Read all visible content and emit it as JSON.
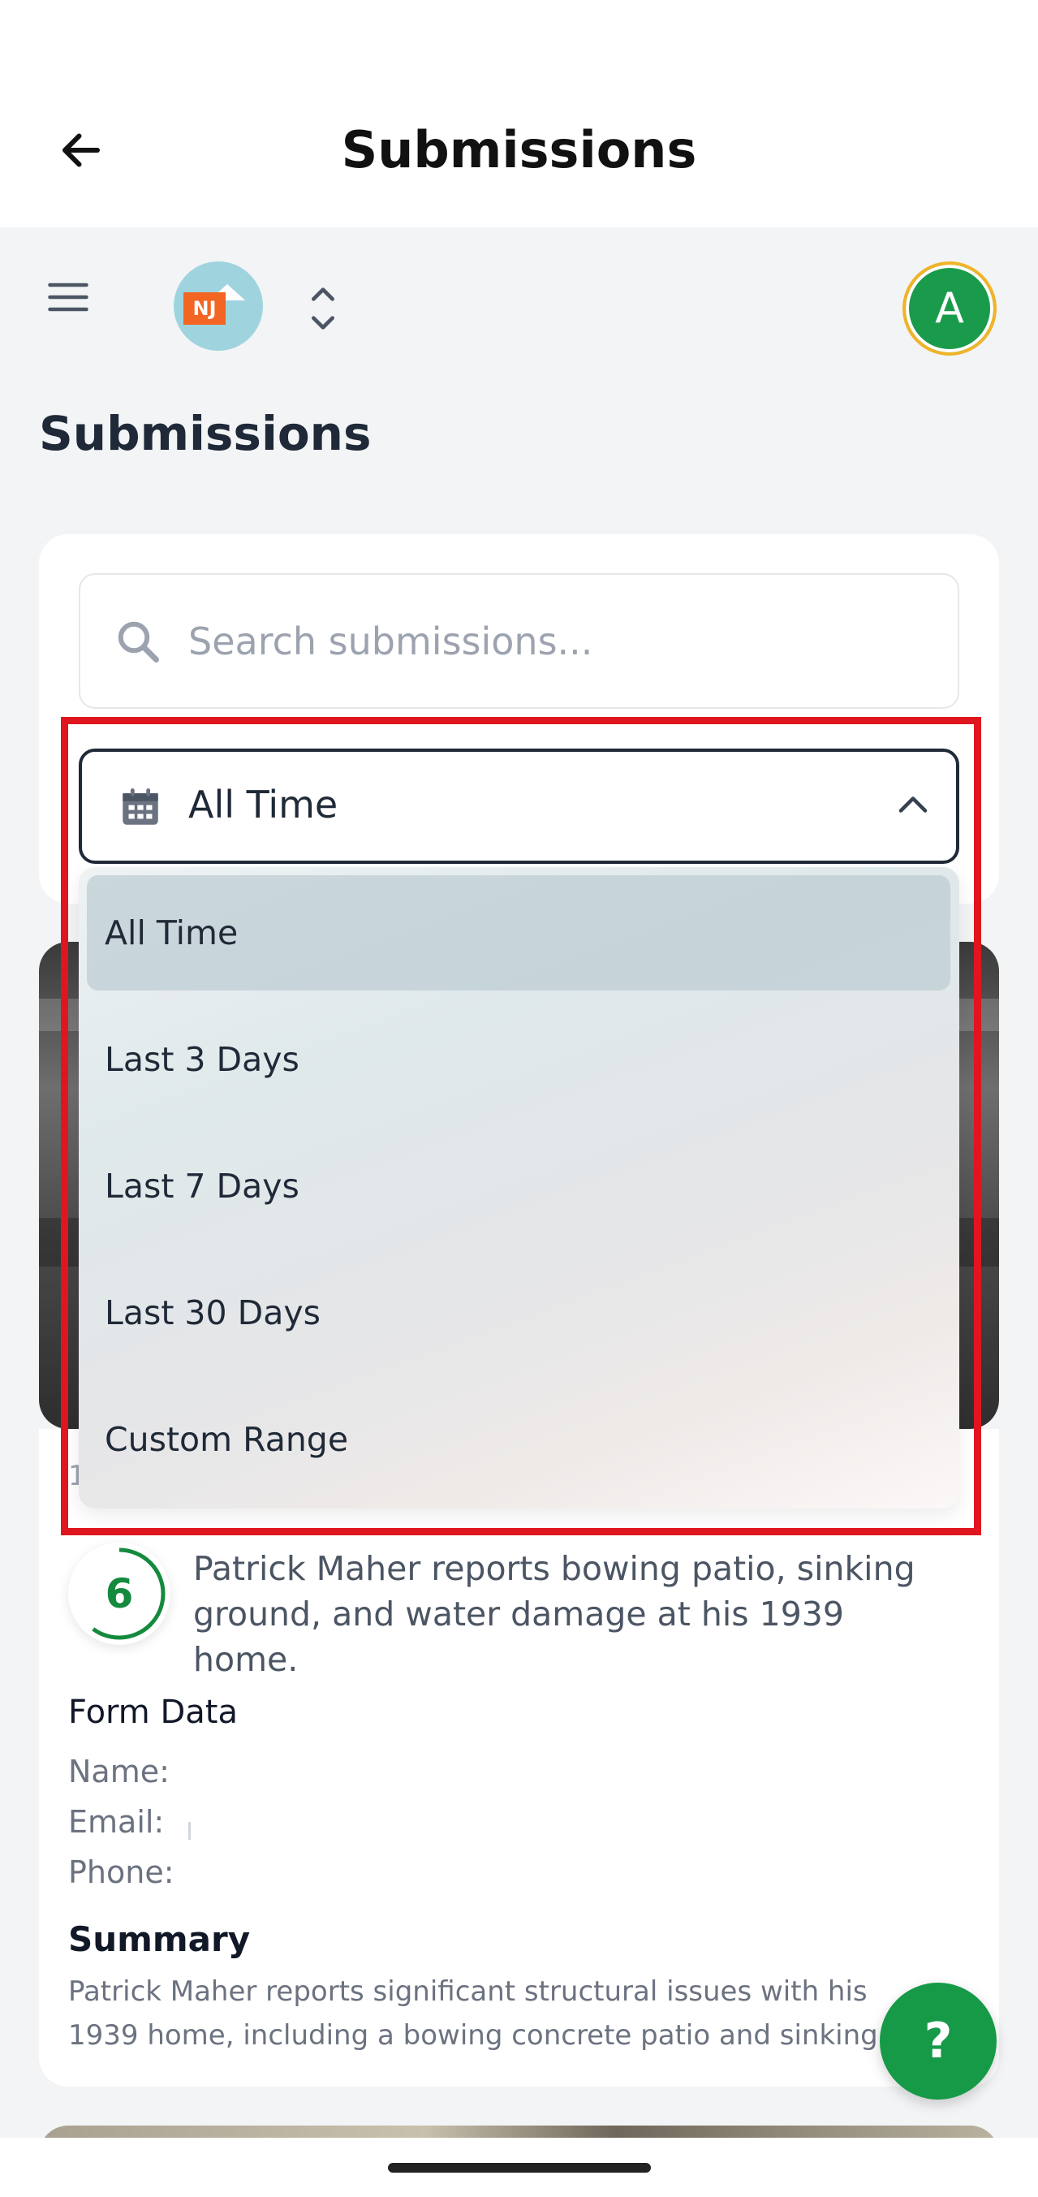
{
  "header": {
    "title": "Submissions"
  },
  "toolbar": {
    "logo_text": "NJ",
    "avatar_initial": "A"
  },
  "page": {
    "heading": "Submissions"
  },
  "search": {
    "placeholder": "Search submissions...",
    "value": ""
  },
  "date_filter": {
    "selected": "All Time",
    "options": [
      "All Time",
      "Last 3 Days",
      "Last 7 Days",
      "Last 30 Days",
      "Custom Range"
    ]
  },
  "submission": {
    "date": "1",
    "score": "6",
    "headline": "Patrick Maher reports bowing patio, sinking ground, and water damage at his 1939 home.",
    "form_data": {
      "title": "Form Data",
      "name_label": "Name:",
      "email_label": "Email:",
      "phone_label": "Phone:"
    },
    "summary_title": "Summary",
    "summary_line1": "Patrick Maher reports significant structural issues with his",
    "summary_line2": "1939 home, including a bowing concrete patio and sinking"
  },
  "help": {
    "label": "?"
  },
  "colors": {
    "brand_green": "#169a48",
    "highlight_red": "#e0161f",
    "avatar_ring": "#f0b429",
    "logo_orange": "#f26522",
    "logo_bg": "#9fd4df"
  }
}
